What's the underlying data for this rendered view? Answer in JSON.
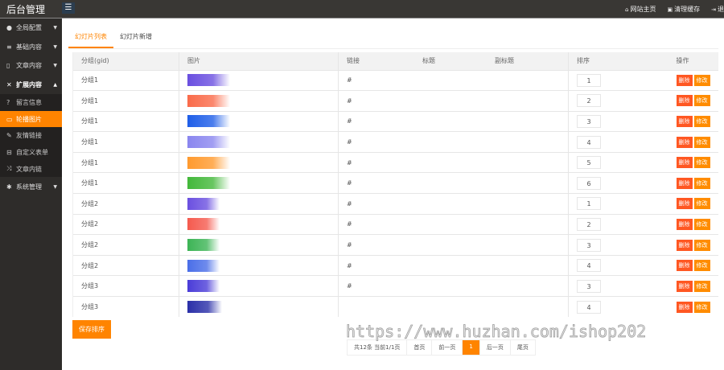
{
  "header": {
    "title": "后台管理",
    "links": [
      {
        "icon": "home-icon",
        "label": "网站主页"
      },
      {
        "icon": "trash-icon",
        "label": "清理缓存"
      },
      {
        "icon": "logout-icon",
        "label": "退"
      }
    ]
  },
  "sidebar": {
    "items": [
      {
        "icon": "globe-icon",
        "label": "全局配置",
        "arrow": "▼"
      },
      {
        "icon": "list-icon",
        "label": "基础内容",
        "arrow": "▼"
      },
      {
        "icon": "file-icon",
        "label": "文章内容",
        "arrow": "▼"
      },
      {
        "icon": "expand-icon",
        "label": "扩展内容",
        "arrow": "▲"
      },
      {
        "icon": "system-icon",
        "label": "系统管理",
        "arrow": "▼"
      }
    ],
    "subitems": [
      {
        "icon": "question-icon",
        "label": "留言信息"
      },
      {
        "icon": "image-icon",
        "label": "轮播图片"
      },
      {
        "icon": "link-icon",
        "label": "友情链接"
      },
      {
        "icon": "form-icon",
        "label": "自定义表单"
      },
      {
        "icon": "shuffle-icon",
        "label": "文章内链"
      }
    ]
  },
  "tabs": [
    "幻灯片列表",
    "幻灯片新增"
  ],
  "table": {
    "headers": [
      "分组(gid)",
      "图片",
      "链接",
      "标题",
      "副标题",
      "排序",
      "操作"
    ],
    "delete_label": "删除",
    "edit_label": "修改",
    "rows": [
      {
        "group": "分组1",
        "link": "#",
        "sort": "1",
        "color": "#6a4fe0"
      },
      {
        "group": "分组1",
        "link": "#",
        "sort": "2",
        "color": "#fa6b4a"
      },
      {
        "group": "分组1",
        "link": "#",
        "sort": "3",
        "color": "#1f5ee8"
      },
      {
        "group": "分组1",
        "link": "#",
        "sort": "4",
        "color": "#8a86ef"
      },
      {
        "group": "分组1",
        "link": "#",
        "sort": "5",
        "color": "#ff9a2e"
      },
      {
        "group": "分组1",
        "link": "#",
        "sort": "6",
        "color": "#43b83a"
      },
      {
        "group": "分组2",
        "link": "#",
        "sort": "1",
        "color": "#6a4fe0"
      },
      {
        "group": "分组2",
        "link": "#",
        "sort": "2",
        "color": "#f55a4e"
      },
      {
        "group": "分组2",
        "link": "#",
        "sort": "3",
        "color": "#3cb455"
      },
      {
        "group": "分组2",
        "link": "#",
        "sort": "4",
        "color": "#4a6ee8"
      },
      {
        "group": "分组3",
        "link": "#",
        "sort": "3",
        "color": "#4a3cd8"
      },
      {
        "group": "分组3",
        "link": "",
        "sort": "4",
        "color": "#2a2fa8"
      }
    ]
  },
  "save_label": "保存排序",
  "pager": {
    "summary": "共12条 当前1/1页",
    "first": "首页",
    "prev": "前一页",
    "current": "1",
    "next": "后一页",
    "last": "尾页"
  },
  "watermark": "https://www.huzhan.com/ishop202"
}
